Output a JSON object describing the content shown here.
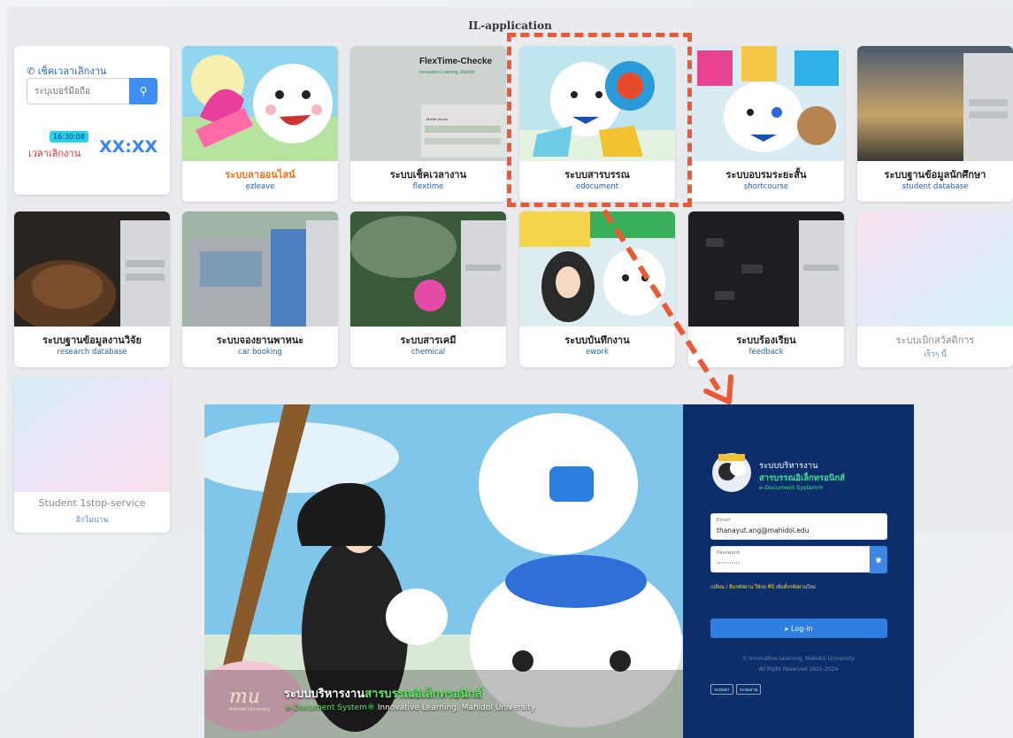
{
  "panel": {
    "title": "IL-application"
  },
  "check_time": {
    "title": "เช็คเวลาเลิกงาน",
    "placeholder": "ระบุเบอร์มือถือ",
    "search_icon": "search-icon",
    "current_time": "16:30:08",
    "label": "เวลาเลิกงาน",
    "value": "XX:XX"
  },
  "apps": [
    {
      "name": "ระบบลาออนไลน์",
      "sub": "ezleave"
    },
    {
      "name": "ระบบเช็คเวลางาน",
      "sub": "flextime"
    },
    {
      "name": "ระบบสารบรรณ",
      "sub": "edocument"
    },
    {
      "name": "ระบบอบรมระยะสั้น",
      "sub": "shortcourse"
    },
    {
      "name": "ระบบฐานข้อมูลนักศึกษา",
      "sub": "student database"
    },
    {
      "name": "ระบบฐานข้อมูลงานวิจัย",
      "sub": "research database"
    },
    {
      "name": "ระบบจองยานพาหนะ",
      "sub": "car booking"
    },
    {
      "name": "ระบบสารเคมี",
      "sub": "chemical"
    },
    {
      "name": "ระบบบันทึกงาน",
      "sub": "ework"
    },
    {
      "name": "ระบบร้องเรียน",
      "sub": "feedback"
    },
    {
      "name": "ระบบเบิกสวัสดิการ",
      "sub": "เร็วๆ นี้"
    },
    {
      "name": "Student 1stop-service",
      "sub": "อีกไม่นาน"
    }
  ],
  "thumb_text": {
    "flextime": "FlexTime-Checke",
    "flextime_sub": "Innovative Learning, Mahido",
    "flextime_field": "Mobile phone"
  },
  "login": {
    "brand_line1": "ระบบบริหารงาน",
    "brand_line2": "สารบรรณอิเล็กทรอนิกส์",
    "brand_line3": "e-Document System®",
    "email_label": "Email",
    "email_value": "thanayut.ang@mahidol.edu",
    "password_label": "Password",
    "password_value": "···········",
    "forgot_text": "เปลี่ยน / ลืมรหัสผ่าน ให้กด ที่นี่ เพื่อตั้งรหัสผ่านใหม่",
    "login_button": "▸ Log-in",
    "copyright1": "© Innovative Learning, Mahidol University",
    "copyright2": "All Right Reserved 2021-2024",
    "mini1": "ระบบลา",
    "mini2": "ระบบงาน",
    "caption_main": "ระบบบริหารงาน",
    "caption_green": "สารบรรณอิเล็กทรอนิกส์",
    "caption_sub_green": "e-Document System®",
    "caption_sub": "Innovative Learning, Mahidol University",
    "logo_text": "mu",
    "logo_sub": "Mahidol University"
  },
  "colors": {
    "accent": "#3f8ef3",
    "highlight": "#ea5a34",
    "login_bg": "#0c2f6b",
    "green": "#3fe08f"
  }
}
